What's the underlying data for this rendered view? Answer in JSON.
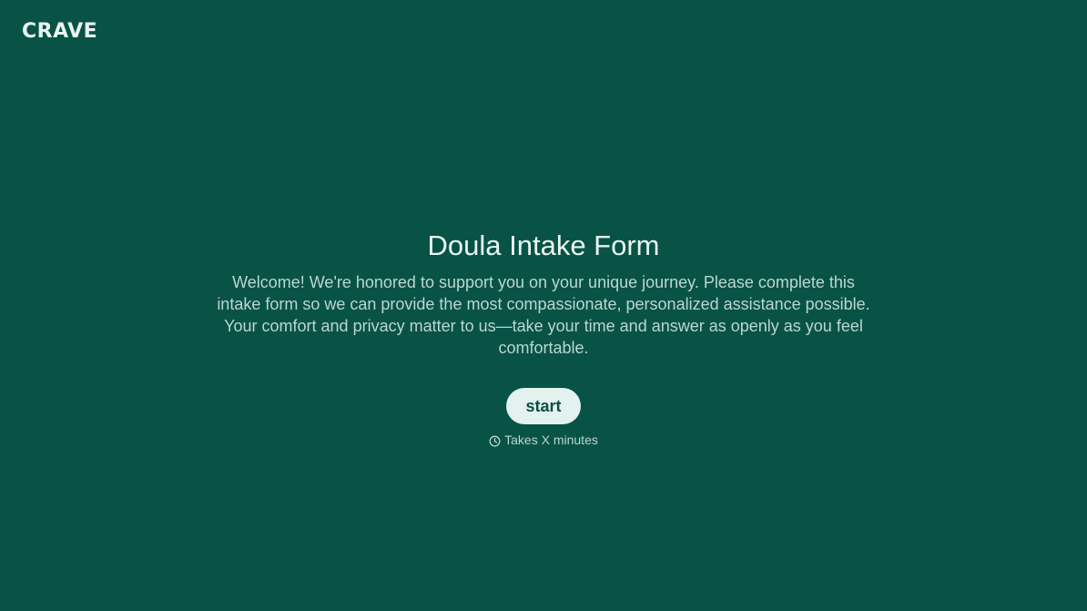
{
  "header": {
    "logo_text": "CRAVE"
  },
  "main": {
    "title": "Doula Intake Form",
    "intro": "Welcome! We're honored to support you on your unique journey. Please complete this intake form so we can provide the most compassionate, personalized assistance possible. Your comfort and privacy matter to us—take your time and answer as openly as you feel comfortable.",
    "start_label": "start",
    "duration_icon": "clock-icon",
    "duration_text": "Takes X minutes"
  },
  "colors": {
    "background": "#095246",
    "title_text": "#e8f4f1",
    "body_text": "#b9d7d0",
    "button_bg": "#e3f2ee",
    "button_text": "#0b4f45"
  }
}
